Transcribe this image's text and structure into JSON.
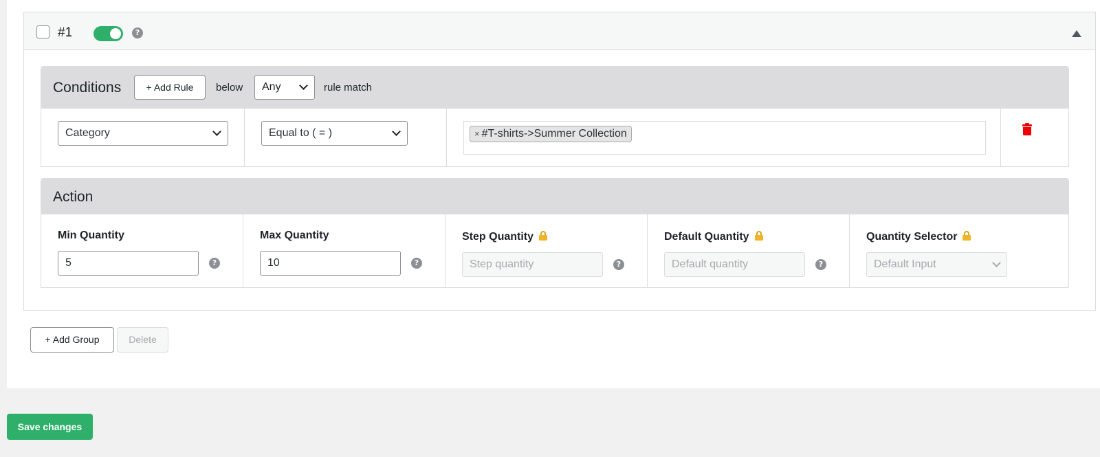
{
  "group": {
    "number": "#1",
    "enabled": true
  },
  "conditions": {
    "title": "Conditions",
    "add_rule_label": "+ Add Rule",
    "below_label": "below",
    "match_value": "Any",
    "rule_match_label": "rule match",
    "rule": {
      "field": "Category",
      "operator": "Equal to ( = )",
      "values": [
        "#T-shirts->Summer Collection"
      ]
    }
  },
  "action": {
    "title": "Action",
    "fields": [
      {
        "label": "Min Quantity",
        "value": "5",
        "placeholder": "",
        "locked": false
      },
      {
        "label": "Max Quantity",
        "value": "10",
        "placeholder": "",
        "locked": false
      },
      {
        "label": "Step Quantity",
        "value": "",
        "placeholder": "Step quantity",
        "locked": true
      },
      {
        "label": "Default Quantity",
        "value": "",
        "placeholder": "Default quantity",
        "locked": true
      },
      {
        "label": "Quantity Selector",
        "value": "Default Input",
        "placeholder": "",
        "locked": true
      }
    ]
  },
  "footer": {
    "add_group_label": "+ Add Group",
    "delete_label": "Delete",
    "save_label": "Save changes"
  },
  "colors": {
    "accent": "#2fb06a",
    "danger": "#ee0000",
    "lock": "#f0b429"
  },
  "icons": {
    "help": "question-circle-icon",
    "collapse": "caret-up-icon",
    "delete_rule": "trash-icon",
    "lock": "lock-icon"
  }
}
